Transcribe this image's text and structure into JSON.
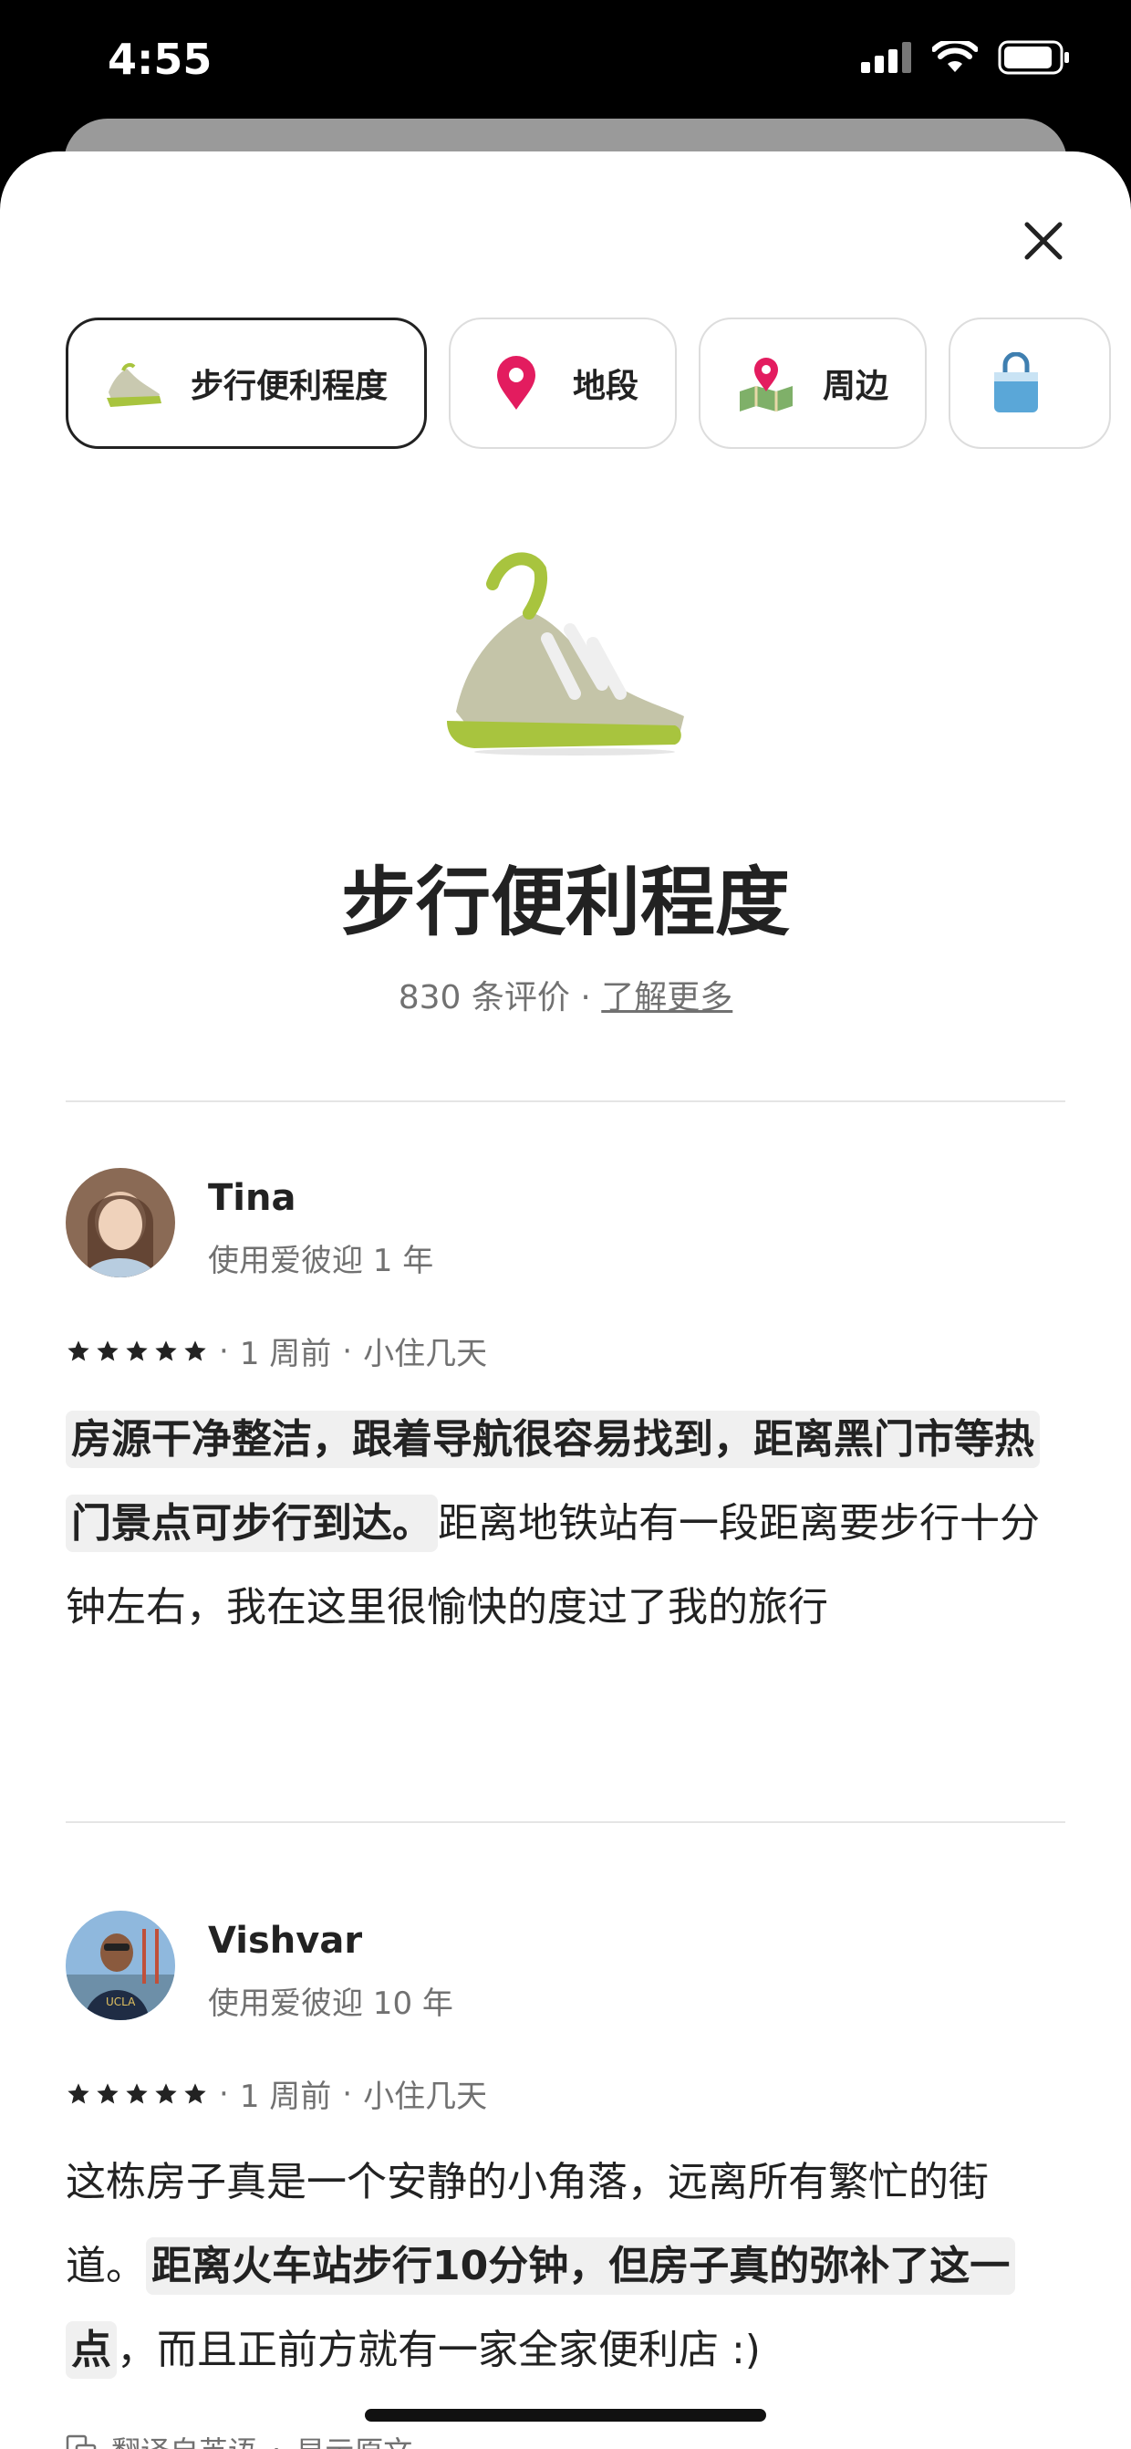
{
  "status_bar": {
    "time": "4:55"
  },
  "tabs": [
    {
      "label": "步行便利程度",
      "icon": "shoe-icon",
      "active": true
    },
    {
      "label": "地段",
      "icon": "location-pin-icon",
      "active": false
    },
    {
      "label": "周边",
      "icon": "map-icon",
      "active": false
    },
    {
      "label": "",
      "icon": "shopping-bag-icon",
      "active": false
    }
  ],
  "header": {
    "title": "步行便利程度",
    "review_count": "830 条评价",
    "separator": " · ",
    "learn_more": "了解更多"
  },
  "reviews": [
    {
      "name": "Tina",
      "tenure": "使用爱彼迎 1 年",
      "rating": 5,
      "time": "1 周前",
      "stay": "小住几天",
      "highlight": "房源干净整洁，跟着导航很容易找到，距离黑门市等热门景点可步行到达。",
      "rest": "距离地铁站有一段距离要步行十分钟左右，我在这里很愉快的度过了我的旅行"
    },
    {
      "name": "Vishvar",
      "tenure": "使用爱彼迎 10 年",
      "rating": 5,
      "time": "1 周前",
      "stay": "小住几天",
      "before": "这栋房子真是一个安静的小角落，远离所有繁忙的街道。",
      "highlight": "距离火车站步行10分钟，但房子真的弥补了这一点",
      "after": "，而且正前方就有一家全家便利店 :)"
    }
  ],
  "translation": {
    "note": "翻译自英语",
    "show_original": "显示原文"
  },
  "colors": {
    "text": "#222222",
    "muted": "#717171",
    "pin": "#E31C5F",
    "shoe_green": "#A8C43E"
  }
}
